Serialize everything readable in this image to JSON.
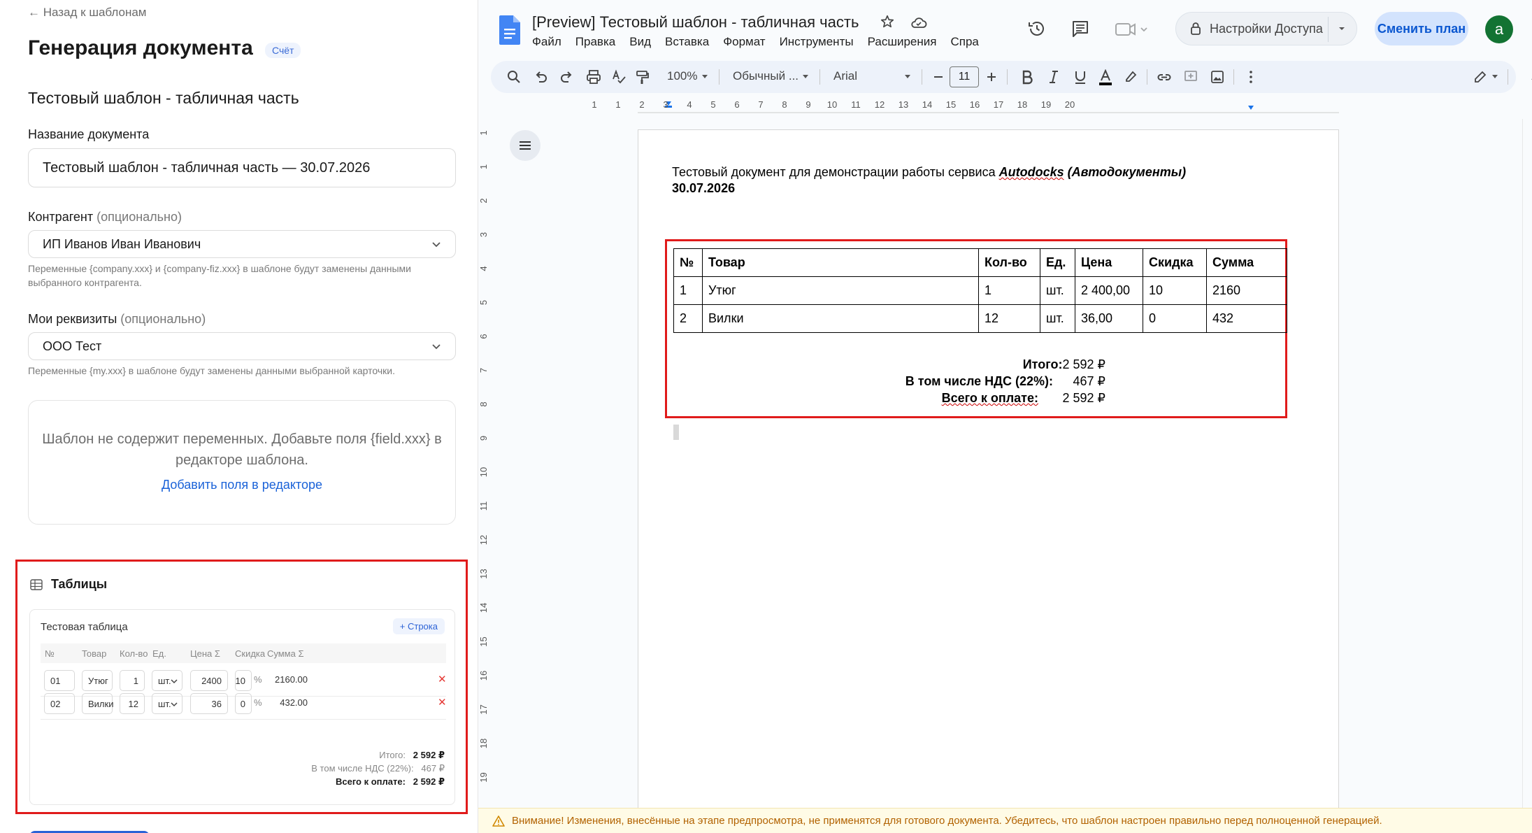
{
  "left": {
    "back_link": "← Назад к шаблонам",
    "title": "Генерация документа",
    "badge": "Счёт",
    "template_name": "Тестовый шаблон - табличная часть",
    "doc_name_label": "Название документа",
    "doc_name_value": "Тестовый шаблон - табличная часть — 30.07.2026",
    "counterparty_label": "Контрагент",
    "counterparty_optional": "(опционально)",
    "counterparty_value": "ИП Иванов Иван Иванович",
    "counterparty_hint": "Переменные {company.xxx} и {company-fiz.xxx} в шаблоне будут заменены данными выбранного контрагента.",
    "requisites_label": "Мои реквизиты",
    "requisites_optional": "(опционально)",
    "requisites_value": "ООО Тест",
    "requisites_hint": "Переменные {my.xxx} в шаблоне будут заменены данными выбранной карточки.",
    "empty_message": "Шаблон не содержит переменных. Добавьте поля {field.xxx} в редакторе шаблона.",
    "empty_link": "Добавить поля в редакторе",
    "tables_heading": "Таблицы",
    "table": {
      "name": "Тестовая таблица",
      "add_row": "+ Строка",
      "headers": {
        "num": "№",
        "item": "Товар",
        "qty": "Кол-во",
        "unit": "Ед.",
        "price": "Цена Σ",
        "discount": "Скидка",
        "sum": "Сумма Σ"
      },
      "rows": [
        {
          "num": "01",
          "item": "Утюг",
          "qty": "1",
          "unit": "шт.",
          "price": "2400",
          "discount": "10",
          "pct": "%",
          "sum": "2160.00",
          "del": "✕"
        },
        {
          "num": "02",
          "item": "Вилки",
          "qty": "12",
          "unit": "шт.",
          "price": "36",
          "discount": "0",
          "pct": "%",
          "sum": "432.00",
          "del": "✕"
        }
      ],
      "total_label": "Итого:",
      "total_value": "2 592 ₽",
      "vat_label": "В том числе НДС (22%):",
      "vat_value": "467 ₽",
      "due_label": "Всего к оплате:",
      "due_value": "2 592 ₽"
    }
  },
  "docs": {
    "title": "[Preview] Тестовый шаблон - табличная часть",
    "menu": [
      "Файл",
      "Правка",
      "Вид",
      "Вставка",
      "Формат",
      "Инструменты",
      "Расширения",
      "Спра"
    ],
    "share_label": "Настройки Доступа",
    "plan_button": "Сменить план",
    "avatar_letter": "a",
    "toolbar": {
      "zoom": "100%",
      "style": "Обычный ...",
      "font": "Arial",
      "font_size": "11"
    },
    "ruler_h": [
      "1",
      "1",
      "2",
      "3",
      "4",
      "5",
      "6",
      "7",
      "8",
      "9",
      "10",
      "11",
      "12",
      "13",
      "14",
      "15",
      "16",
      "17",
      "18",
      "19",
      "20"
    ],
    "ruler_v": [
      "1",
      "1",
      "2",
      "3",
      "4",
      "5",
      "6",
      "7",
      "8",
      "9",
      "10",
      "11",
      "12",
      "13",
      "14",
      "15",
      "16",
      "17",
      "18",
      "19"
    ],
    "doc": {
      "intro": "Тестовый документ для демонстрации работы сервиса ",
      "brand": "Autodocks",
      "brand_suffix": " (Автодокументы)",
      "date": "30.07.2026",
      "headers": [
        "№",
        "Товар",
        "Кол-во",
        "Ед.",
        "Цена",
        "Скидка",
        "Сумма"
      ],
      "rows": [
        [
          "1",
          "Утюг",
          "1",
          "шт.",
          "2 400,00",
          "10",
          "2160"
        ],
        [
          "2",
          "Вилки",
          "12",
          "шт.",
          "36,00",
          "0",
          "432"
        ]
      ],
      "total_label": "Итого:",
      "total_value": "2 592 ₽",
      "vat_label": "В том числе НДС (22%):",
      "vat_value": "467 ₽",
      "due_label": "Всего к оплате:",
      "due_value": "2 592 ₽"
    },
    "warning": "Внимание! Изменения, внесённые на этапе предпросмотра, не применятся для готового документа. Убедитесь, что шаблон настроен правильно перед полноценной генерацией."
  }
}
